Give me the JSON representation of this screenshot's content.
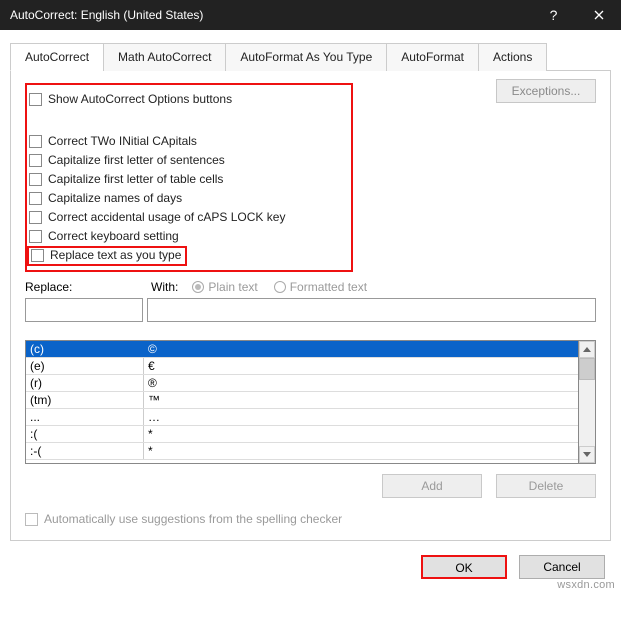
{
  "window": {
    "title": "AutoCorrect: English (United States)"
  },
  "tabs": [
    "AutoCorrect",
    "Math AutoCorrect",
    "AutoFormat As You Type",
    "AutoFormat",
    "Actions"
  ],
  "active_tab": 0,
  "checkboxes": [
    "Show AutoCorrect Options buttons",
    "Correct TWo INitial CApitals",
    "Capitalize first letter of sentences",
    "Capitalize first letter of table cells",
    "Capitalize names of days",
    "Correct accidental usage of cAPS LOCK key",
    "Correct keyboard setting",
    "Replace text as you type"
  ],
  "exceptions_label": "Exceptions...",
  "labels": {
    "replace": "Replace:",
    "with": "With:",
    "plain": "Plain text",
    "formatted": "Formatted text",
    "add": "Add",
    "delete": "Delete",
    "auto_suggest": "Automatically use suggestions from the spelling checker",
    "ok": "OK",
    "cancel": "Cancel"
  },
  "replace_input": "",
  "with_input": "",
  "entries": [
    {
      "from": "(c)",
      "to": "©"
    },
    {
      "from": "(e)",
      "to": "€"
    },
    {
      "from": "(r)",
      "to": "®"
    },
    {
      "from": "(tm)",
      "to": "™"
    },
    {
      "from": "...",
      "to": "…"
    },
    {
      "from": ":(",
      "to": "*"
    },
    {
      "from": ":-(",
      "to": "*"
    }
  ],
  "selected_entry": 0,
  "watermark": "wsxdn.com"
}
